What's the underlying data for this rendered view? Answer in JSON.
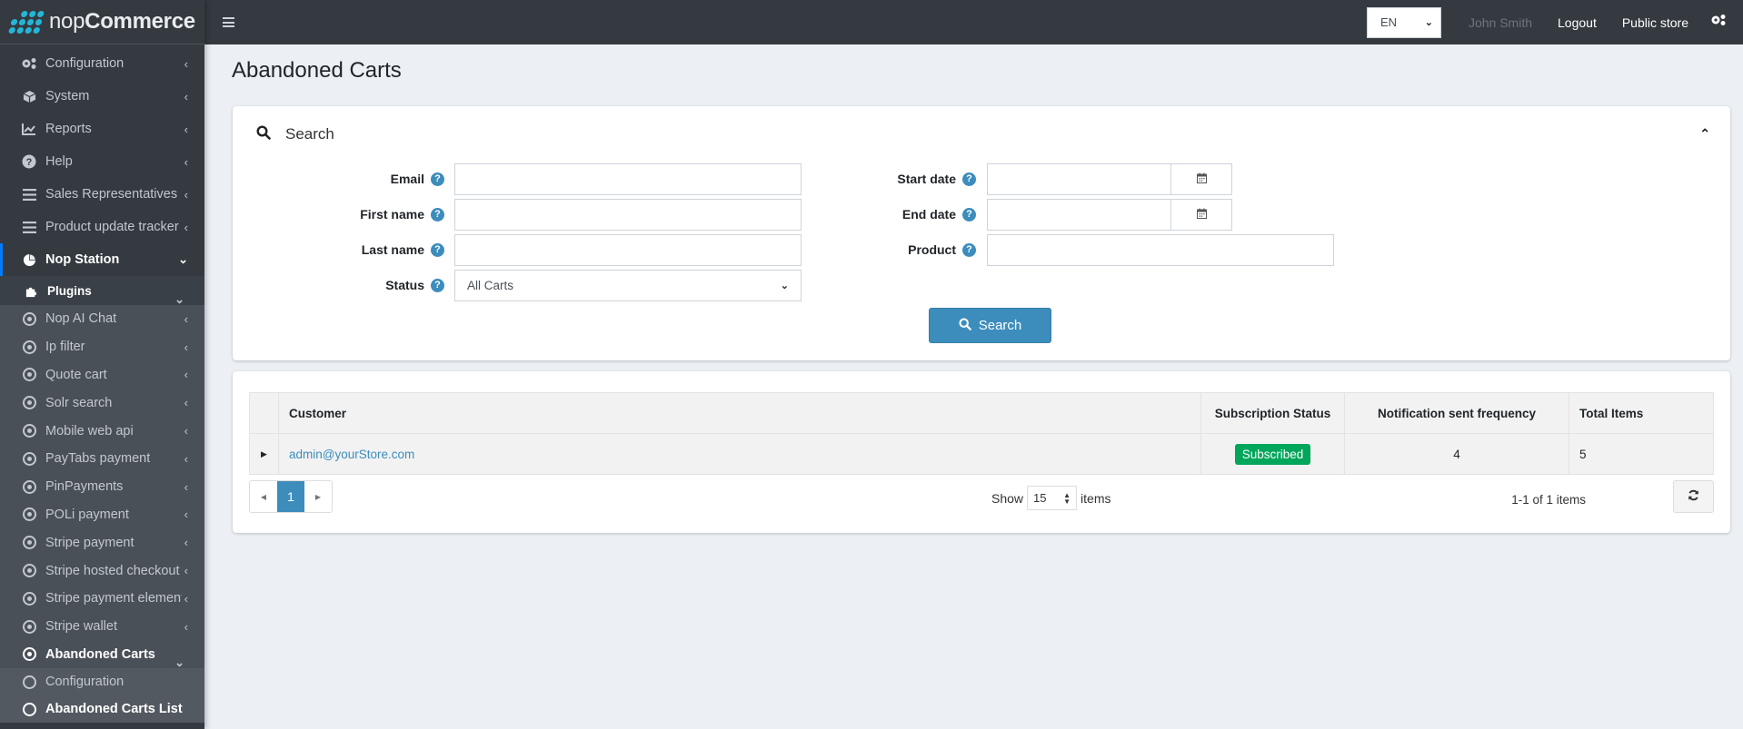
{
  "brand": {
    "name_light": "nop",
    "name_bold": "Commerce"
  },
  "sidebar": {
    "top_items": [
      {
        "label": "Configuration",
        "icon": "gears-icon"
      },
      {
        "label": "System",
        "icon": "cube-icon"
      },
      {
        "label": "Reports",
        "icon": "chart-line-icon"
      },
      {
        "label": "Help",
        "icon": "question-circle-icon"
      },
      {
        "label": "Sales Representatives",
        "icon": "list-icon"
      },
      {
        "label": "Product update tracker",
        "icon": "list-icon"
      },
      {
        "label": "Nop Station",
        "icon": "pie-icon"
      }
    ],
    "plugins_label": "Plugins",
    "plugin_items": [
      "Nop AI Chat",
      "Ip filter",
      "Quote cart",
      "Solr search",
      "Mobile web api",
      "PayTabs payment",
      "PinPayments",
      "POLi payment",
      "Stripe payment",
      "Stripe hosted checkout",
      "Stripe payment element",
      "Stripe wallet",
      "Abandoned Carts"
    ],
    "leaf_items": [
      "Configuration",
      "Abandoned Carts List"
    ]
  },
  "topbar": {
    "language": "EN",
    "user_name": "John Smith",
    "logout": "Logout",
    "public_store": "Public store"
  },
  "page": {
    "title": "Abandoned Carts"
  },
  "search": {
    "header": "Search",
    "fields": {
      "email": {
        "label": "Email",
        "value": ""
      },
      "first_name": {
        "label": "First name",
        "value": ""
      },
      "last_name": {
        "label": "Last name",
        "value": ""
      },
      "status": {
        "label": "Status",
        "value": "All Carts"
      },
      "start_date": {
        "label": "Start date",
        "value": ""
      },
      "end_date": {
        "label": "End date",
        "value": ""
      },
      "product": {
        "label": "Product",
        "value": ""
      }
    },
    "button": "Search"
  },
  "grid": {
    "columns": [
      "Customer",
      "Subscription Status",
      "Notification sent frequency",
      "Total Items"
    ],
    "rows": [
      {
        "customer": "admin@yourStore.com",
        "subscription_status": "Subscribed",
        "notification_frequency": "4",
        "total_items": "5"
      }
    ],
    "pager": {
      "current_page": "1",
      "show_label": "Show",
      "page_size": "15",
      "items_label": "items",
      "range_info": "1-1 of 1 items"
    }
  },
  "colors": {
    "sidebar_bg": "#343a40",
    "accent": "#3c8dbc",
    "badge_success": "#00a65a",
    "brand_dots": "#24b5d8"
  }
}
